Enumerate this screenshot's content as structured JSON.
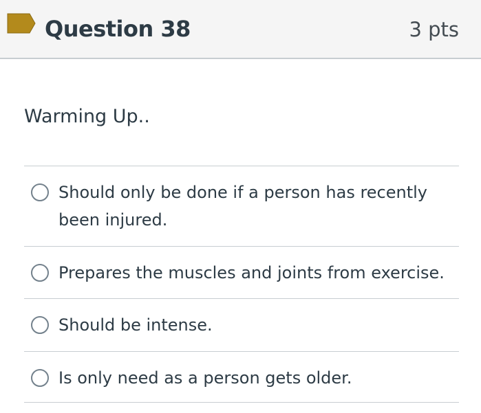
{
  "header": {
    "flag_icon": "flag-icon",
    "flag_color": "#b38a1c",
    "title": "Question 38",
    "points": "3 pts"
  },
  "question": {
    "text": "Warming Up.."
  },
  "answers": [
    {
      "label": "Should only be done if a person has recently been injured.",
      "selected": false
    },
    {
      "label": "Prepares the muscles and joints from exercise.",
      "selected": false
    },
    {
      "label": "Should be intense.",
      "selected": false
    },
    {
      "label": "Is only need as a person gets older.",
      "selected": false
    }
  ]
}
